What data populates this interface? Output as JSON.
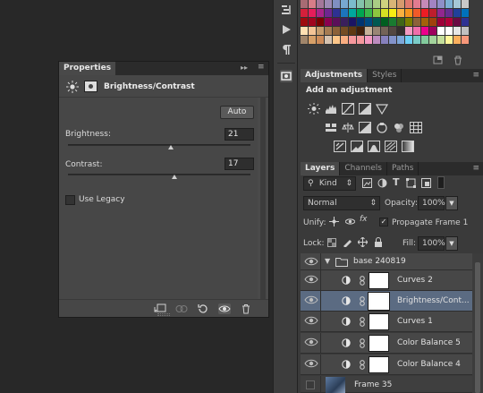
{
  "swatches": [
    "#a86b73",
    "#d77d88",
    "#a4779a",
    "#9c8ab4",
    "#7f8fc1",
    "#77a8d1",
    "#7bbccc",
    "#83c3ab",
    "#86c08b",
    "#a9cd85",
    "#cfd27f",
    "#d9b476",
    "#d69a6e",
    "#e07a6f",
    "#e27b90",
    "#c58ab8",
    "#a284c3",
    "#8e90c8",
    "#7bb0d4",
    "#a5c8d6",
    "#c8c8c8",
    "#d4203b",
    "#e51d5a",
    "#a82388",
    "#6e2690",
    "#2e3192",
    "#1c75bc",
    "#00a79d",
    "#00a651",
    "#39b54a",
    "#8dc63f",
    "#d7df23",
    "#f7ec13",
    "#fbb040",
    "#f7941d",
    "#f15a29",
    "#ed1c24",
    "#be1e2d",
    "#92278f",
    "#662d91",
    "#21409a",
    "#0072bc",
    "#9e0b0f",
    "#a0041e",
    "#790000",
    "#8b0050",
    "#5b0f59",
    "#3a1f5c",
    "#1b1464",
    "#003471",
    "#004a80",
    "#005952",
    "#005e20",
    "#197b30",
    "#406618",
    "#7b7d00",
    "#8c6239",
    "#a36209",
    "#a0410d",
    "#9e0039",
    "#b20039",
    "#6a0a43",
    "#2e3192",
    "#ffe0b3",
    "#f4c496",
    "#c69c6d",
    "#a67c52",
    "#8c6239",
    "#754c24",
    "#603913",
    "#42210b",
    "#c7b299",
    "#998675",
    "#736357",
    "#534741",
    "#362f2d",
    "#f49ac1",
    "#f06eaa",
    "#ec008c",
    "#9e005d",
    "#ffffff",
    "#ffffff",
    "#e6e6e6",
    "#c0c0c0",
    "#a1866b",
    "#d7a068",
    "#cd8b58",
    "#d6c3b0",
    "#fdc689",
    "#f9ad81",
    "#f6989d",
    "#f5989d",
    "#f49ac2",
    "#bd8cbf",
    "#8781bd",
    "#8393ca",
    "#7da7d9",
    "#6dcff6",
    "#7accc8",
    "#82ca9c",
    "#a3d39c",
    "#c4df9b",
    "#fff79a",
    "#fbaf5d",
    "#f7977a"
  ],
  "adjustments": {
    "tabs": [
      "Adjustments",
      "Styles"
    ],
    "title": "Add an adjustment"
  },
  "properties": {
    "tab": "Properties",
    "title": "Brightness/Contrast",
    "auto_label": "Auto",
    "brightness_label": "Brightness:",
    "brightness_value": "21",
    "contrast_label": "Contrast:",
    "contrast_value": "17",
    "legacy_label": "Use Legacy"
  },
  "layers": {
    "tabs": [
      "Layers",
      "Channels",
      "Paths"
    ],
    "kind_label": "Kind",
    "blend_mode": "Normal",
    "opacity_label": "Opacity:",
    "opacity_value": "100%",
    "unify_label": "Unify:",
    "propagate_label": "Propagate Frame 1",
    "lock_label": "Lock:",
    "fill_label": "Fill:",
    "fill_value": "100%",
    "group_name": "base 240819",
    "rows": [
      {
        "name": "Curves 2"
      },
      {
        "name": "Brightness/Cont..."
      },
      {
        "name": "Curves 1"
      },
      {
        "name": "Color Balance 5"
      },
      {
        "name": "Color Balance 4"
      }
    ],
    "frame_name": "Frame 35"
  }
}
